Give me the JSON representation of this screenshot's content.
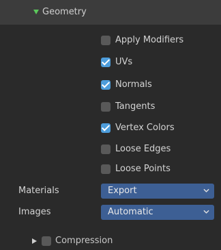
{
  "panel": {
    "title": "Geometry",
    "checkboxes": [
      {
        "label": "Apply Modifiers",
        "checked": false
      },
      {
        "label": "UVs",
        "checked": true
      },
      {
        "label": "Normals",
        "checked": true
      },
      {
        "label": "Tangents",
        "checked": false
      },
      {
        "label": "Vertex Colors",
        "checked": true
      },
      {
        "label": "Loose Edges",
        "checked": false
      },
      {
        "label": "Loose Points",
        "checked": false
      }
    ],
    "materials": {
      "label": "Materials",
      "value": "Export"
    },
    "images": {
      "label": "Images",
      "value": "Automatic"
    },
    "compression": {
      "label": "Compression",
      "checked": false
    }
  },
  "colors": {
    "background": "#2a2a2a",
    "header": "#3c3c3c",
    "checkbox_on": "#4d9ddb",
    "checkbox_off": "#595959",
    "dropdown": "#3d5f94",
    "expanded_triangle": "#5bc85b"
  },
  "icons": {
    "expand": "triangle-down-icon",
    "collapse": "triangle-right-icon",
    "dropdown": "chevron-down-icon",
    "check": "checkmark-icon"
  }
}
